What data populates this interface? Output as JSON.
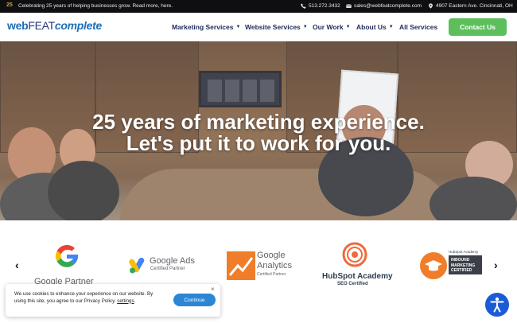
{
  "topbar": {
    "badge": "25",
    "promo": "Celebrating 25 years of helping businesses grow. Read more, here.",
    "phone": "513.272.3432",
    "email": "sales@webfeatcomplete.com",
    "address": "4907 Eastern Ave. Cincinnati, OH"
  },
  "header": {
    "logo_web": "web",
    "logo_feat": "FEAT",
    "logo_complete": "complete",
    "nav": [
      {
        "label": "Marketing Services"
      },
      {
        "label": "Website Services"
      },
      {
        "label": "Our Work"
      },
      {
        "label": "About Us"
      },
      {
        "label": "All Services"
      }
    ],
    "contact_label": "Contact Us"
  },
  "hero": {
    "line1": "25 years of marketing experience.",
    "line2": "Let's put it to work for you."
  },
  "partners": {
    "google_partner": "Google Partner",
    "google_ads": "Google Ads",
    "google_ads_sub": "Certified Partner",
    "analytics_google": "Google",
    "analytics_name": "Analytics",
    "analytics_sub": "Certified Partner",
    "hubspot_name": "HubSpot Academy",
    "hubspot_sub": "SEO Certified",
    "inbound_top": "HubSpot Academy",
    "inbound_l1": "INBOUND",
    "inbound_l2": "MARKETING",
    "inbound_l3": "CERTIFIED",
    "prev": "‹",
    "next": "›"
  },
  "cookie": {
    "text_part1": "We use cookies to enhance your experience on our website. By using this site, you agree to our Privacy Policy.",
    "settings_link": "settings",
    "button": "Continue",
    "close": "×"
  },
  "colors": {
    "brand_blue": "#1e6fb7",
    "nav_navy": "#1e2a5a",
    "contact_green": "#5cbf5c",
    "cookie_button": "#2b86d4",
    "a11y_blue": "#1a5bd6"
  }
}
